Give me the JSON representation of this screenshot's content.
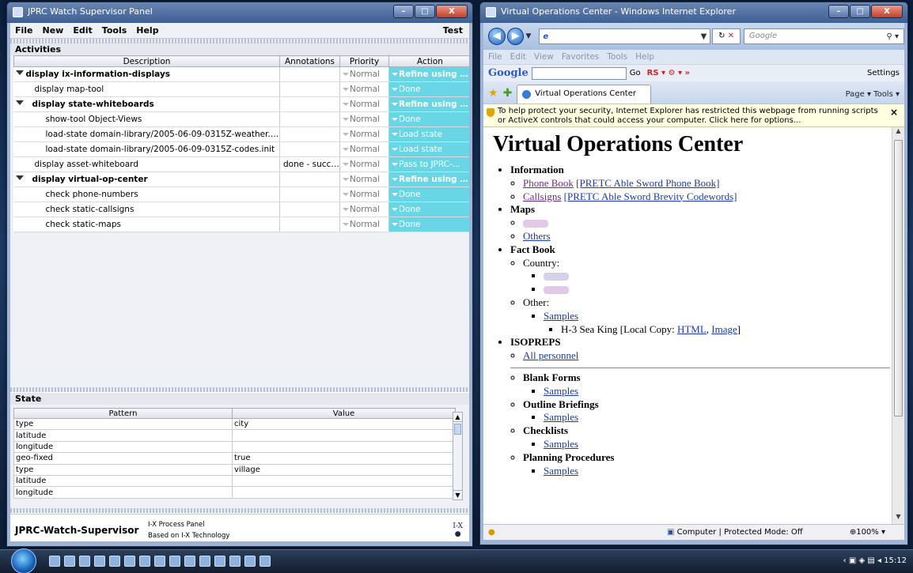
{
  "left_window": {
    "title": "JPRC Watch Supervisor Panel",
    "menu": [
      "File",
      "New",
      "Edit",
      "Tools",
      "Help"
    ],
    "menu_right": "Test",
    "activities_title": "Activities",
    "columns": [
      "Description",
      "Annotations",
      "Priority",
      "Action"
    ],
    "rows": [
      {
        "desc": "display ix-information-displays",
        "ann": "",
        "pri": "Normal",
        "act": "Refine using b...",
        "bold": true,
        "tri": true
      },
      {
        "desc": "display map-tool",
        "ann": "",
        "pri": "Normal",
        "act": "Done",
        "bold": false,
        "tri": false
      },
      {
        "desc": "display state-whiteboards",
        "ann": "",
        "pri": "Normal",
        "act": "Refine using d...",
        "bold": true,
        "tri": true
      },
      {
        "desc": "show-tool Object-Views",
        "ann": "",
        "pri": "Normal",
        "act": "Done",
        "bold": false,
        "tri": false
      },
      {
        "desc": "load-state domain-library/2005-06-09-0315Z-weather.init",
        "ann": "",
        "pri": "Normal",
        "act": "Load state",
        "bold": false,
        "tri": false
      },
      {
        "desc": "load-state domain-library/2005-06-09-0315Z-codes.init",
        "ann": "",
        "pri": "Normal",
        "act": "Load state",
        "bold": false,
        "tri": false
      },
      {
        "desc": "display asset-whiteboard",
        "ann": "done - succe...",
        "pri": "Normal",
        "act": "Pass to JPRC-...",
        "bold": false,
        "tri": false
      },
      {
        "desc": "display virtual-op-center",
        "ann": "",
        "pri": "Normal",
        "act": "Refine using d...",
        "bold": true,
        "tri": true
      },
      {
        "desc": "check phone-numbers",
        "ann": "",
        "pri": "Normal",
        "act": "Done",
        "bold": false,
        "tri": false
      },
      {
        "desc": "check static-callsigns",
        "ann": "",
        "pri": "Normal",
        "act": "Done",
        "bold": false,
        "tri": false
      },
      {
        "desc": "check static-maps",
        "ann": "",
        "pri": "Normal",
        "act": "Done",
        "bold": false,
        "tri": false
      }
    ],
    "state_title": "State",
    "state_columns": [
      "Pattern",
      "Value"
    ],
    "state_rows": [
      [
        "type",
        "city"
      ],
      [
        "latitude",
        ""
      ],
      [
        "longitude",
        ""
      ],
      [
        "geo-fixed",
        "true"
      ],
      [
        "type",
        "village"
      ],
      [
        "latitude",
        ""
      ],
      [
        "longitude",
        ""
      ]
    ],
    "footer_name": "JPRC-Watch-Supervisor",
    "footer_line1": "I-X Process Panel",
    "footer_line2": "Based on I-X Technology",
    "footer_logo": "I-X"
  },
  "ie_window": {
    "title": "Virtual Operations Center - Windows Internet Explorer",
    "address_glyph": "e",
    "search_placeholder": "Google",
    "menu": [
      "File",
      "Edit",
      "View",
      "Favorites",
      "Tools",
      "Help"
    ],
    "google_logo": "Google",
    "google_go": "Go",
    "google_settings": "Settings",
    "tab_label": "Virtual Operations Center",
    "tab_commands": "Page ▾  Tools ▾",
    "infobar_text": "To help protect your security, Internet Explorer has restricted this webpage from running scripts or ActiveX controls that could access your computer. Click here for options...",
    "page": {
      "heading": "Virtual Operations Center",
      "information": "Information",
      "phone_book": "Phone Book",
      "phone_book_link2": "[PRETC Able Sword Phone Book]",
      "callsigns": "Callsigns",
      "callsigns_link2": "[PRETC Able Sword Brevity Codewords]",
      "maps": "Maps",
      "others": "Others",
      "fact_book": "Fact Book",
      "country": "Country:",
      "other": "Other:",
      "samples": "Samples",
      "seaking": "H-3 Sea King [Local Copy: ",
      "html": "HTML",
      "image": "Image",
      "isopreps": "ISOPREPS",
      "all_personnel": "All personnel",
      "blank_forms": "Blank Forms",
      "outline_briefings": "Outline Briefings",
      "checklists": "Checklists",
      "planning_procedures": "Planning Procedures"
    },
    "status_zone": "Computer | Protected Mode: Off",
    "status_zoom": "100%"
  },
  "taskbar": {
    "clock": "15:12"
  }
}
